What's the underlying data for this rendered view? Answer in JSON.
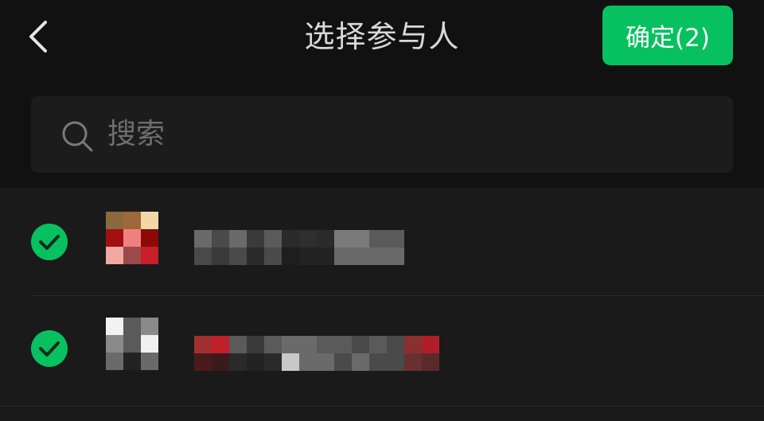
{
  "header": {
    "title": "选择参与人",
    "confirm_label": "确定(2)",
    "back_icon": "chevron-left-icon"
  },
  "search": {
    "placeholder": "搜索",
    "icon": "search-icon"
  },
  "colors": {
    "background": "#111111",
    "list_background": "#1a1a1a",
    "accent_green": "#07c160",
    "title_text": "#d8d8d8",
    "placeholder_text": "#6e6e6e"
  },
  "participants": [
    {
      "selected": true,
      "avatar_colors": [
        "#8a6a3c",
        "#9c6a3a",
        "#f1d8a4",
        "#a01010",
        "#f08080",
        "#8a0a0a",
        "#f0a8a0",
        "#9a4a4a",
        "#c81e2a"
      ],
      "name_mosaic": [
        [
          "#6a6a6a",
          "#4a4a4a",
          "#6a6a6a",
          "#3a3a3a",
          "#5a5a5a",
          "#2a2a2a",
          "#2e2e2e",
          "#2a2a2a",
          "#7a7a7a",
          "#7a7a7a",
          "#5a5a5a",
          "#5a5a5a"
        ],
        [
          "#4a4a4a",
          "#3a3a3a",
          "#4a4a4a",
          "#2a2a2a",
          "#4a4a4a",
          "#1e1e1e",
          "#222222",
          "#222222",
          "#6a6a6a",
          "#6a6a6a",
          "#6a6a6a",
          "#6a6a6a"
        ]
      ]
    },
    {
      "selected": true,
      "avatar_colors": [
        "#f2f2f2",
        "#5a5a5a",
        "#8a8a8a",
        "#8a8a8a",
        "#5a5a5a",
        "#f0f0f0",
        "#6a6a6a",
        "#222222",
        "#6a6a6a"
      ],
      "name_mosaic": [
        [
          "#a03030",
          "#c0202a",
          "#5a5a5a",
          "#3a3a3a",
          "#5a5a5a",
          "#6a6a6a",
          "#6a6a6a",
          "#5a5a5a",
          "#5a5a5a",
          "#4a4a4a",
          "#5a5a5a",
          "#4a4a4a",
          "#8a3030",
          "#b01e2a"
        ],
        [
          "#4a1a1a",
          "#3a1a1a",
          "#2a2a2a",
          "#222222",
          "#2a2a2a",
          "#c8c8c8",
          "#6a6a6a",
          "#6a6a6a",
          "#4a4a4a",
          "#6a6a6a",
          "#4a4a4a",
          "#4a4a4a",
          "#6a3030",
          "#5a2a2a"
        ]
      ]
    }
  ]
}
